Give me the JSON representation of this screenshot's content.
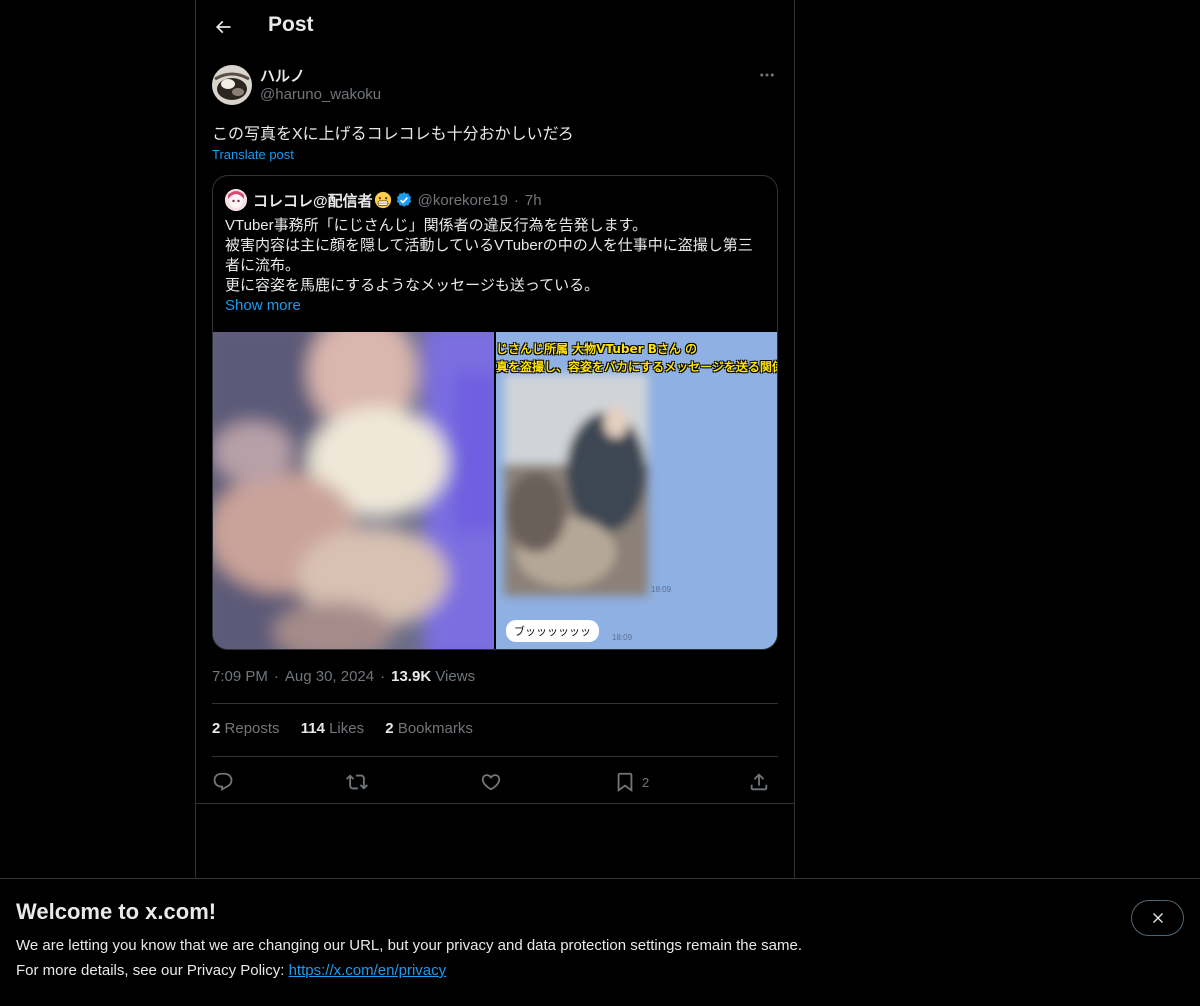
{
  "header": {
    "title": "Post",
    "back_icon": "arrow-left-icon"
  },
  "post": {
    "author_name": "ハルノ",
    "author_handle": "@haruno_wakoku",
    "text": "この写真をXに上げるコレコレも十分おかしいだろ",
    "translate_label": "Translate post",
    "time": "7:09 PM",
    "date": "Aug 30, 2024",
    "views_count": "13.9K",
    "views_label": "Views"
  },
  "quote": {
    "author_name": "コレコレ@配信者",
    "author_handle": "@korekore19",
    "time": "7h",
    "lines": [
      "VTuber事務所「にじさんじ」関係者の違反行為を告発します。",
      "被害内容は主に顔を隠して活動しているVTuberの中の人を仕事中に盗撮し第三",
      "者に流布。",
      "更に容姿を馬鹿にするようなメッセージも送っている。"
    ],
    "show_more": "Show more",
    "media_caption_line1": "じさんじ所属 大物VTuber Bさん の",
    "media_caption_line2": "真を盗撮し、容姿をバカにするメッセージを送る関係",
    "media_bubble": "ブッッッッッッ",
    "media_time1": "18:09",
    "media_time2": "18:09"
  },
  "stats": {
    "reposts_count": "2",
    "reposts_label": "Reposts",
    "likes_count": "114",
    "likes_label": "Likes",
    "bookmarks_count": "2",
    "bookmarks_label": "Bookmarks"
  },
  "actions": {
    "bookmark_count": "2"
  },
  "banner": {
    "title": "Welcome to x.com!",
    "line1": "We are letting you know that we are changing our URL, but your privacy and data protection settings remain the same.",
    "line2_prefix": "For more details, see our Privacy Policy: ",
    "link": "https://x.com/en/privacy"
  },
  "colors": {
    "background": "#000000",
    "text": "#e7e9ea",
    "secondary": "#71767b",
    "accent": "#1d9bf0",
    "border": "#2f3336"
  }
}
